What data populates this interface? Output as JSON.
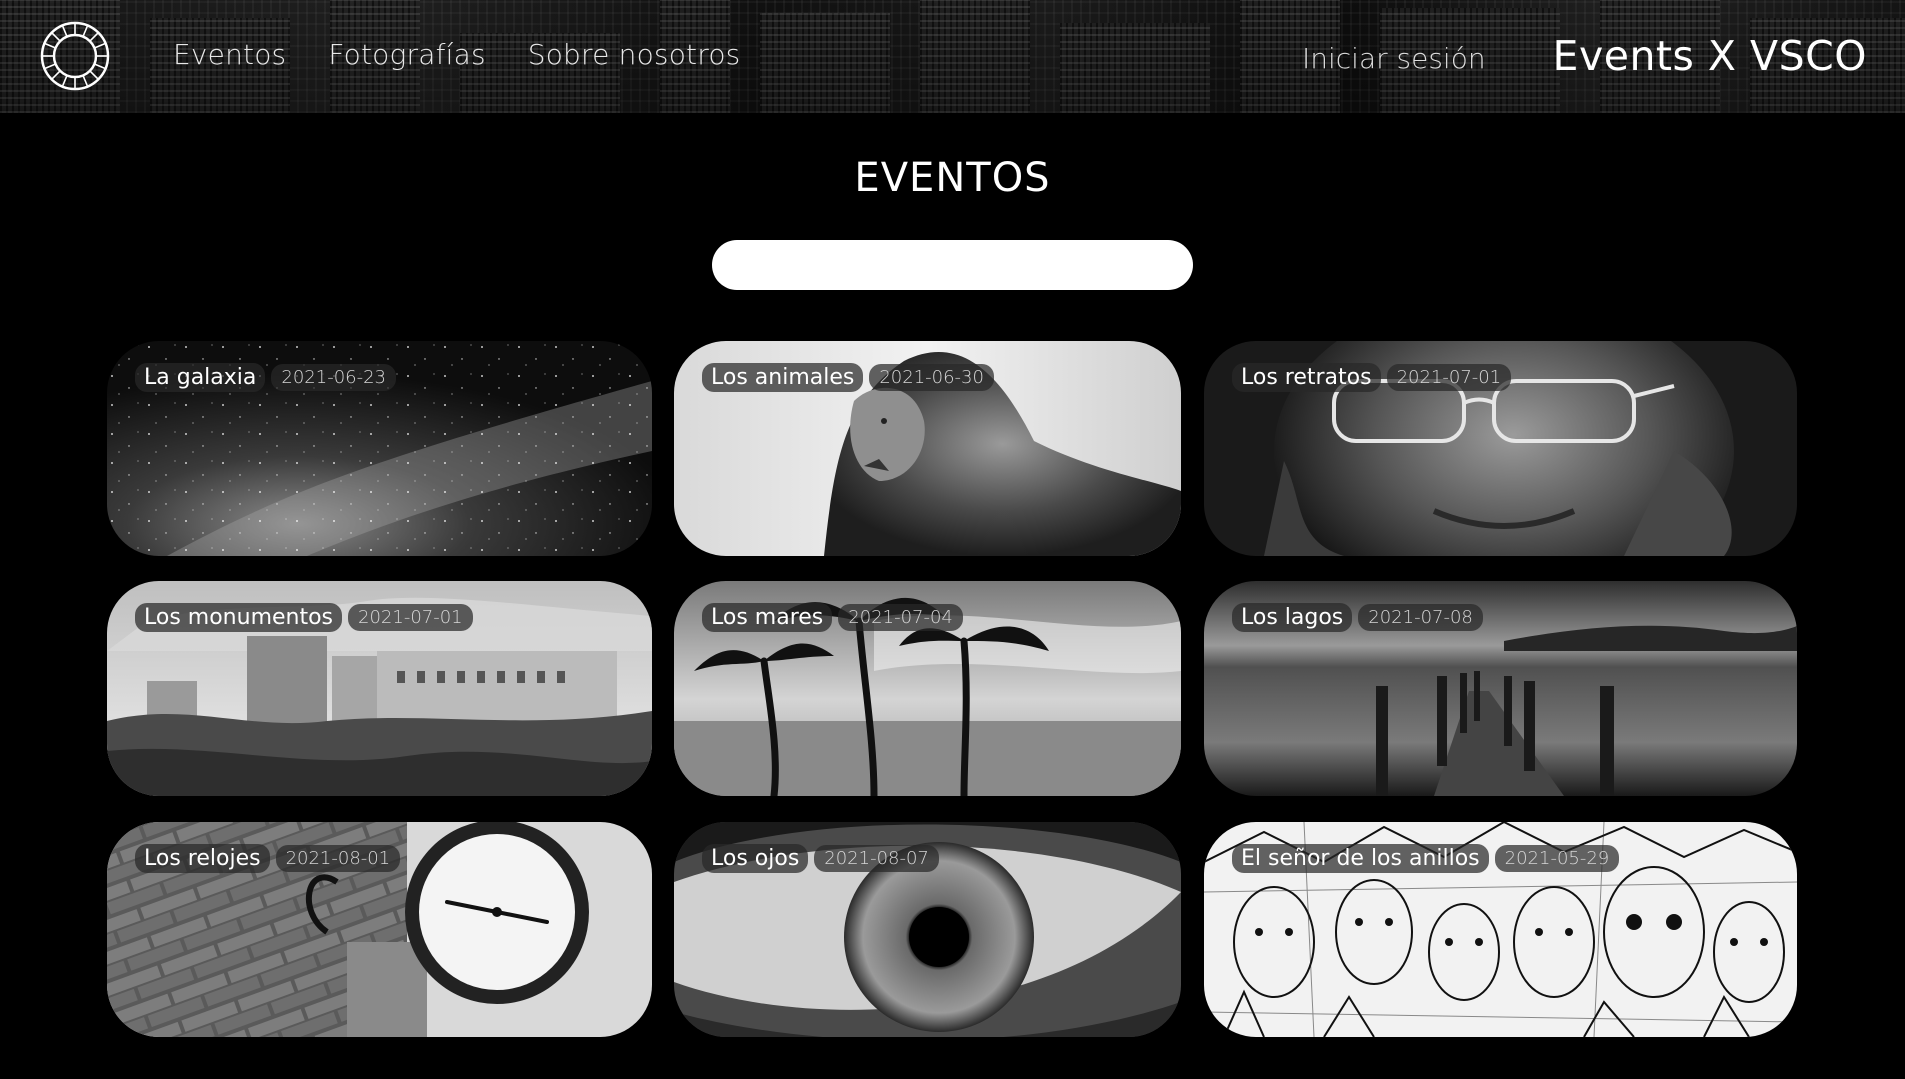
{
  "header": {
    "logo_icon": "vsco-ring-logo-icon",
    "nav": [
      "Eventos",
      "Fotografías",
      "Sobre nosotros"
    ],
    "login_label": "Iniciar sesión",
    "brand": "Events X VSCO"
  },
  "main": {
    "title": "EVENTOS",
    "search": {
      "value": "",
      "placeholder": ""
    },
    "events": [
      {
        "name": "La galaxia",
        "date": "2021-06-23"
      },
      {
        "name": "Los animales",
        "date": "2021-06-30"
      },
      {
        "name": "Los retratos",
        "date": "2021-07-01"
      },
      {
        "name": "Los monumentos",
        "date": "2021-07-01"
      },
      {
        "name": "Los mares",
        "date": "2021-07-04"
      },
      {
        "name": "Los lagos",
        "date": "2021-07-08"
      },
      {
        "name": "Los relojes",
        "date": "2021-08-01"
      },
      {
        "name": "Los ojos",
        "date": "2021-08-07"
      },
      {
        "name": "El señor de los anillos",
        "date": "2021-05-29"
      }
    ]
  },
  "colors": {
    "background": "#000000",
    "text": "#ffffff",
    "search_bg": "#ffffff",
    "label_bg": "#282828"
  }
}
